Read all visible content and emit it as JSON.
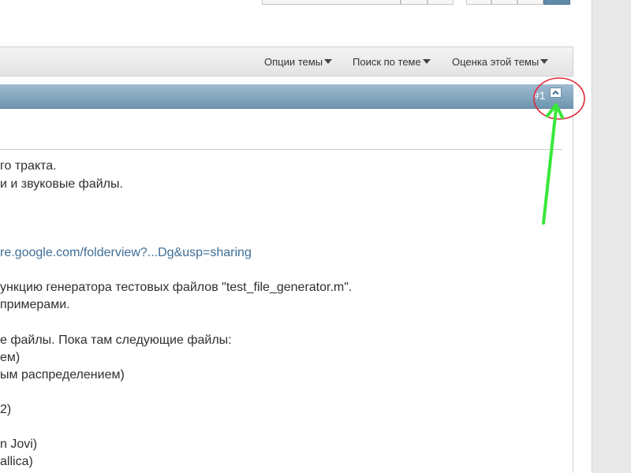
{
  "thread_tools": {
    "options": "Опции темы",
    "search": "Поиск по теме",
    "rate": "Оценка этой темы"
  },
  "post": {
    "number": "#1",
    "lines": [
      "го тракта.",
      "и и звуковые файлы.",
      "",
      "",
      "re.google.com/folderview?...Dg&usp=sharing",
      "",
      "ункцию генератора тестовых файлов \"test_file_generator.m\".",
      "примерами.",
      "",
      "е файлы. Пока там следующие файлы:",
      "ем)",
      "ым распределением)",
      "",
      "2)",
      "",
      "n Jovi)",
      "allica)"
    ]
  },
  "colors": {
    "header_gradient_top": "#9fbbcf",
    "header_gradient_bottom": "#6e95b1",
    "link": "#3d6d96",
    "annotation_circle": "#e0283a",
    "annotation_arrow": "#39e83a"
  },
  "icons": {
    "scroll_top": "chevron-up-icon",
    "dropdown": "caret-down-icon"
  }
}
